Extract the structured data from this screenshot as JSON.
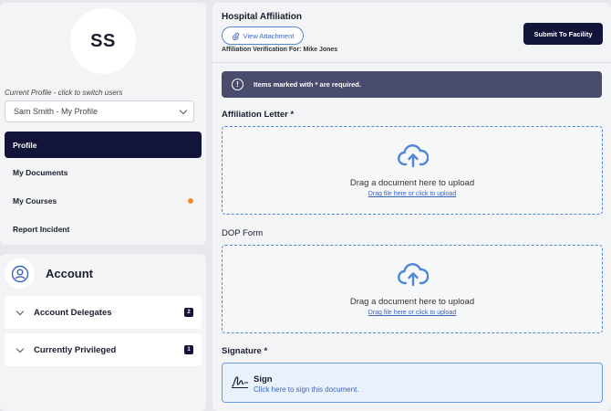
{
  "profile": {
    "initials": "SS",
    "hint": "Current Profile - click to switch users",
    "selected_user": "Sam Smith - My Profile"
  },
  "nav": {
    "items": [
      {
        "label": "Profile",
        "active": true
      },
      {
        "label": "My Documents"
      },
      {
        "label": "My Courses",
        "notification": true
      },
      {
        "label": "Report Incident"
      }
    ]
  },
  "account": {
    "title": "Account",
    "sections": [
      {
        "label": "Account Delegates",
        "count": "2"
      },
      {
        "label": "Currently Privileged",
        "count": "1"
      }
    ]
  },
  "main": {
    "title": "Hospital Affiliation",
    "view_attachment_label": "View Attachment",
    "verification": "Affiliation Verification For: Mike Jones",
    "submit_label": "Submit To Facility",
    "alert": "Items marked with * are required.",
    "alert_icon": "!",
    "fields": [
      {
        "label": "Affiliation Letter *",
        "drop_text": "Drag a document here to upload",
        "link_text": "Drag file here or click to upload"
      },
      {
        "label": "DOP Form",
        "drop_text": "Drag a document here to upload",
        "link_text": "Drag file here or click to upload"
      }
    ],
    "signature": {
      "label": "Signature *",
      "title": "Sign",
      "subtitle": "Click here to sign this document."
    }
  },
  "colors": {
    "primary_dark": "#12143a",
    "accent_blue": "#4e86d8",
    "notification_orange": "#f08c2c",
    "alert_bg": "#4a4c6e"
  },
  "icons": [
    "chevron-down-icon",
    "user-circle-icon",
    "paperclip-icon",
    "alert-circle-icon",
    "cloud-upload-icon",
    "signature-icon"
  ]
}
